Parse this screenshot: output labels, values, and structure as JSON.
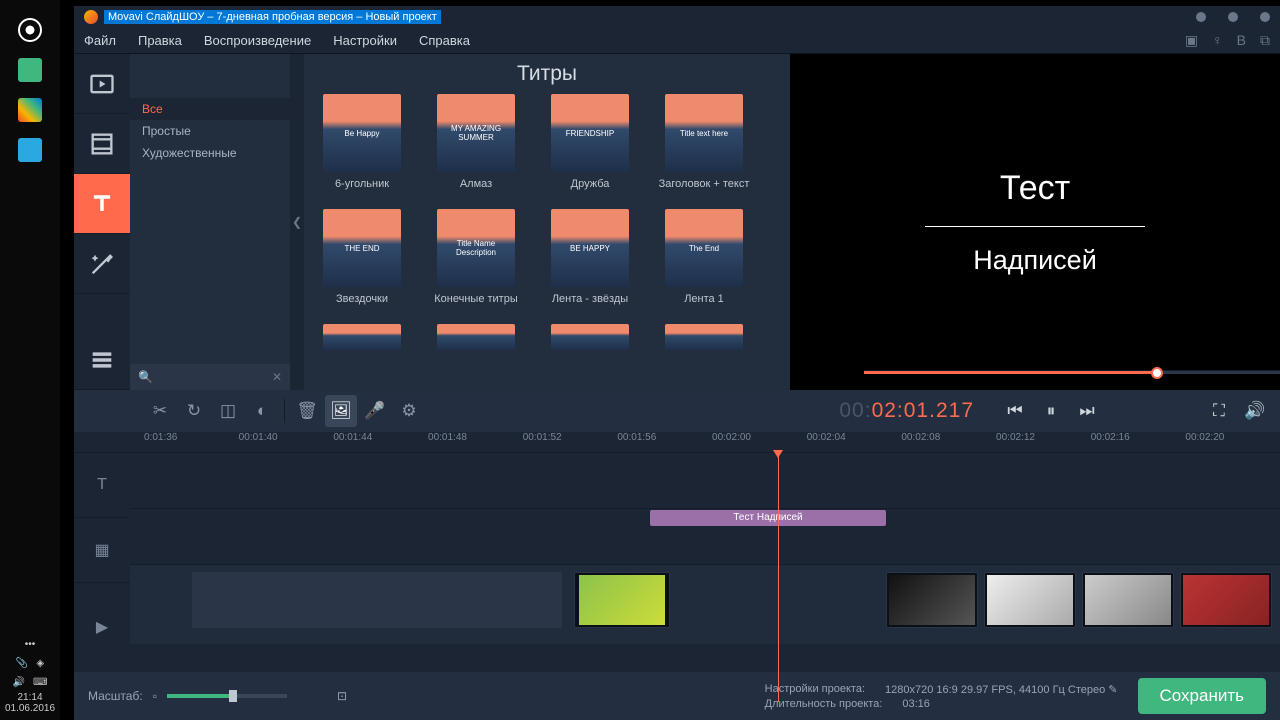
{
  "desktop_time": "21:14",
  "desktop_date": "01.06.2016",
  "window_title": "Movavi СлайдШОУ – 7-дневная пробная версия – Новый проект",
  "menu": [
    "Файл",
    "Правка",
    "Воспроизведение",
    "Настройки",
    "Справка"
  ],
  "panel_header": "Титры",
  "categories": [
    {
      "label": "Все",
      "active": true
    },
    {
      "label": "Простые",
      "active": false
    },
    {
      "label": "Художественные",
      "active": false
    }
  ],
  "titles_grid": [
    {
      "label": "6-угольник",
      "overlay": "Be Happy"
    },
    {
      "label": "Алмаз",
      "overlay": "MY AMAZING SUMMER"
    },
    {
      "label": "Дружба",
      "overlay": "FRIENDSHIP"
    },
    {
      "label": "Заголовок + текст",
      "overlay": "Title text here"
    },
    {
      "label": "Звездочки",
      "overlay": "THE END"
    },
    {
      "label": "Конечные титры",
      "overlay": "Title Name Description"
    },
    {
      "label": "Лента - звёзды",
      "overlay": "BE HAPPY"
    },
    {
      "label": "Лента 1",
      "overlay": "The End"
    }
  ],
  "preview": {
    "line1": "Тест",
    "line2": "Надписей"
  },
  "timecode": {
    "gray_prefix": "00:",
    "main": "02:01",
    "suffix": ".217"
  },
  "ruler_ticks": [
    "0:01:36",
    "00:01:40",
    "00:01:44",
    "00:01:48",
    "00:01:52",
    "00:01:56",
    "00:02:00",
    "00:02:04",
    "00:02:08",
    "00:02:12",
    "00:02:16",
    "00:02:20"
  ],
  "title_clip_label": "Тест Надписей",
  "zoom_label": "Масштаб:",
  "project_info": {
    "settings_label": "Настройки проекта:",
    "settings_value": "1280x720 16:9 29.97 FPS, 44100 Гц Стерео",
    "duration_label": "Длительность проекта:",
    "duration_value": "03:16"
  },
  "save_button": "Сохранить"
}
